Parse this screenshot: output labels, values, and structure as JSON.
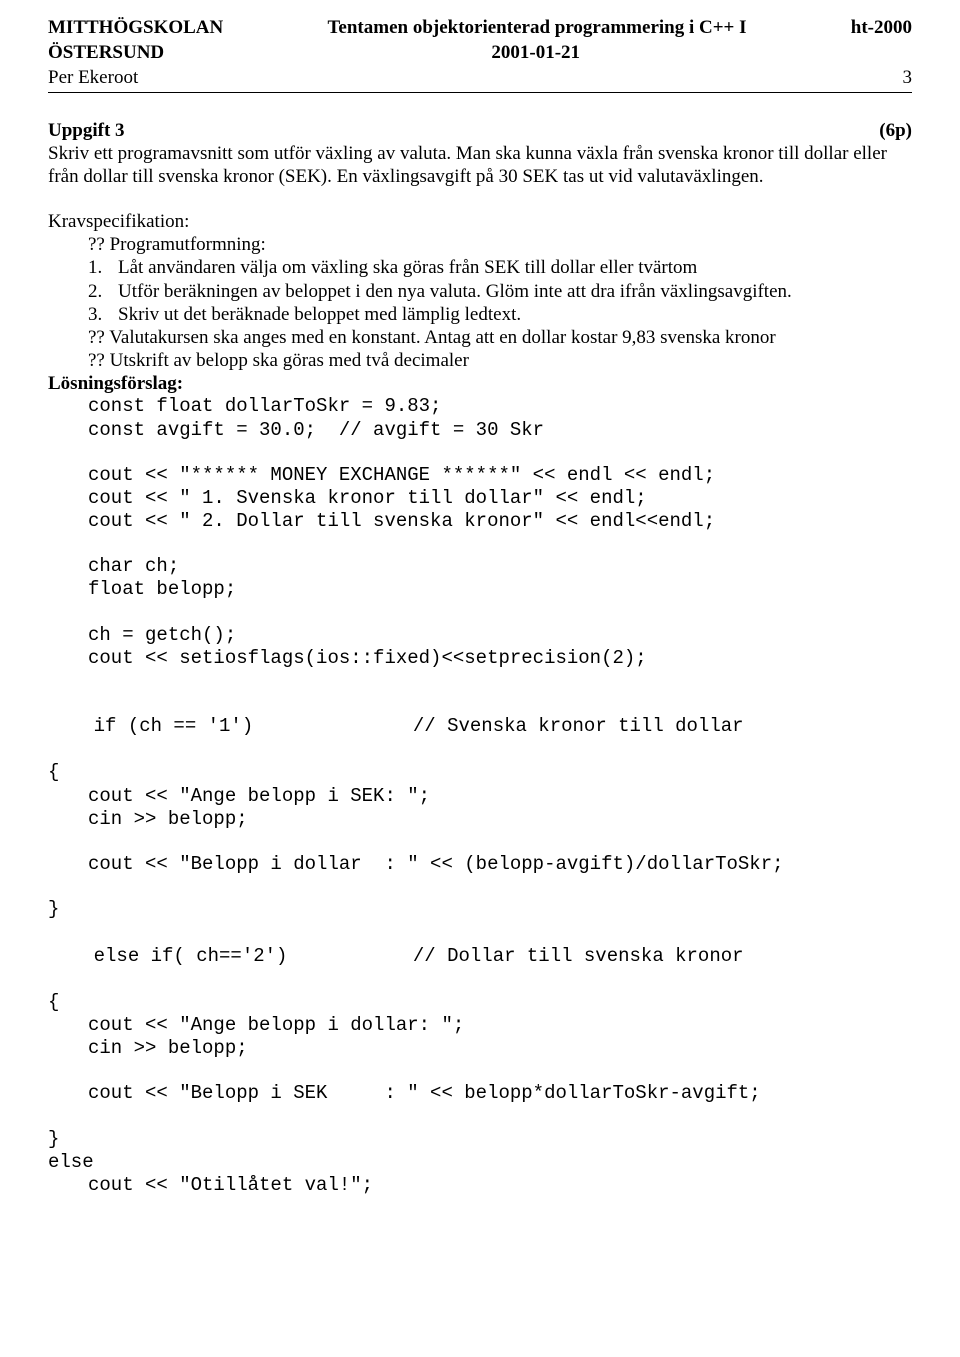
{
  "header": {
    "school": "MITTHÖGSKOLAN",
    "title": "Tentamen objektorienterad programmering i C++ I",
    "term": "ht-2000",
    "city": "ÖSTERSUND",
    "date": "2001-01-21",
    "author": "Per Ekeroot",
    "page": "3"
  },
  "task": {
    "heading": "Uppgift 3",
    "points": "(6p)",
    "intro": "Skriv ett programavsnitt som utför växling av valuta. Man ska kunna växla från svenska kronor till dollar eller från dollar till svenska kronor (SEK). En växlingsavgift på 30 SEK tas ut vid valutaväxlingen.",
    "kravHead": "Kravspecifikation:",
    "bullet1": "?? Programutformning:",
    "numbered": [
      {
        "n": "1.",
        "t": "Låt användaren välja om växling ska göras från SEK till dollar eller tvärtom"
      },
      {
        "n": "2.",
        "t": "Utför beräkningen av beloppet i den nya valuta. Glöm inte att dra ifrån växlingsavgiften."
      },
      {
        "n": "3.",
        "t": "Skriv ut det beräknade beloppet med lämplig ledtext."
      }
    ],
    "bullet2": "?? Valutakursen ska anges med en konstant. Antag att en dollar kostar 9,83 svenska kronor",
    "bullet3": "?? Utskrift av belopp ska göras med två decimaler",
    "solutionHead": "Lösningsförslag:"
  },
  "code": {
    "l01": "const float dollarToSkr = 9.83;",
    "l02": "const avgift = 30.0;  // avgift = 30 Skr",
    "l03": "cout << \"****** MONEY EXCHANGE ******\" << endl << endl;",
    "l04": "cout << \" 1. Svenska kronor till dollar\" << endl;",
    "l05": "cout << \" 2. Dollar till svenska kronor\" << endl<<endl;",
    "l06": "char ch;",
    "l07": "float belopp;",
    "l08": "ch = getch();",
    "l09": "cout << setiosflags(ios::fixed)<<setprecision(2);",
    "l10a": "if (ch == '1')",
    "l10b": "// Svenska kronor till dollar",
    "l11": "{",
    "l12": "cout << \"Ange belopp i SEK: \";",
    "l13": "cin >> belopp;",
    "l14": "cout << \"Belopp i dollar  : \" << (belopp-avgift)/dollarToSkr;",
    "l15": "}",
    "l16a": "else if( ch=='2')",
    "l16b": "// Dollar till svenska kronor",
    "l17": "{",
    "l18": "cout << \"Ange belopp i dollar: \";",
    "l19": "cin >> belopp;",
    "l20": "cout << \"Belopp i SEK     : \" << belopp*dollarToSkr-avgift;",
    "l21": "}",
    "l22": "else",
    "l23": "cout << \"Otillåtet val!\";"
  }
}
